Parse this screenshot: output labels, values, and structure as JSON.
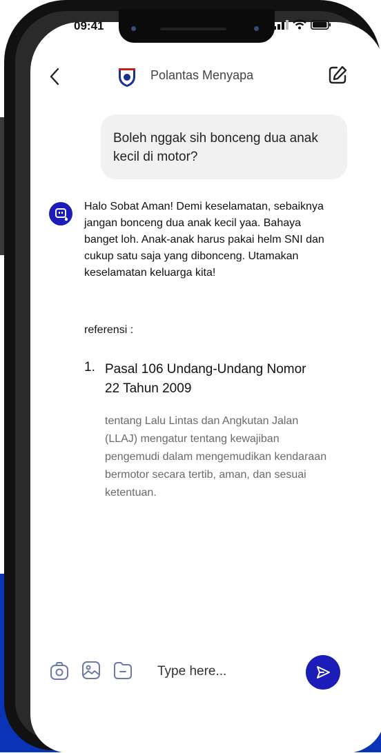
{
  "status_bar": {
    "time": "09:41"
  },
  "header": {
    "title": "Polantas Menyapa"
  },
  "chat": {
    "user_message": "Boleh nggak sih bonceng dua anak kecil di motor?",
    "bot_message": "Halo Sobat Aman! Demi keselamatan, sebaiknya jangan bonceng dua anak kecil yaa. Bahaya banget loh. Anak-anak harus pakai helm SNI dan cukup satu saja yang dibonceng. Utamakan keselamatan keluarga kita!",
    "reference_label": "referensi  :",
    "references": [
      {
        "number": "1.",
        "title": "Pasal 106 Undang-Undang Nomor 22 Tahun 2009",
        "description": "tentang Lalu Lintas dan Angkutan Jalan (LLAJ) mengatur tentang kewajiban pengemudi dalam mengemudikan kendaraan bermotor secara tertib, aman, dan sesuai ketentuan."
      }
    ]
  },
  "composer": {
    "placeholder": "Type here..."
  },
  "colors": {
    "accent": "#1c1cb9",
    "background_blue": "#0a34b8",
    "bubble": "#f1f1f1"
  }
}
